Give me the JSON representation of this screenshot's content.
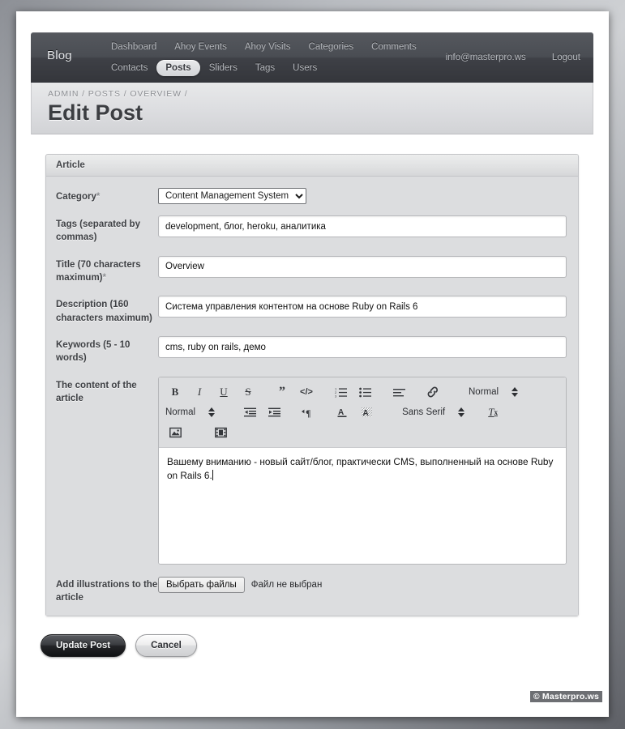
{
  "navbar": {
    "brand": "Blog",
    "row1": [
      {
        "label": "Dashboard",
        "active": false
      },
      {
        "label": "Ahoy Events",
        "active": false
      },
      {
        "label": "Ahoy Visits",
        "active": false
      },
      {
        "label": "Categories",
        "active": false
      },
      {
        "label": "Comments",
        "active": false
      }
    ],
    "row2": [
      {
        "label": "Contacts",
        "active": false
      },
      {
        "label": "Posts",
        "active": true
      },
      {
        "label": "Sliders",
        "active": false
      },
      {
        "label": "Tags",
        "active": false
      },
      {
        "label": "Users",
        "active": false
      }
    ],
    "account": "info@masterpro.ws",
    "logout": "Logout"
  },
  "header": {
    "breadcrumb": "ADMIN / POSTS / OVERVIEW /",
    "title": "Edit Post"
  },
  "panel": {
    "title": "Article"
  },
  "form": {
    "category": {
      "label": "Category",
      "required_mark": "*",
      "value": "Content Management System",
      "options": [
        "Content Management System"
      ]
    },
    "tags": {
      "label": "Tags (separated by commas)",
      "value": "development, блог, heroku, аналитика",
      "placeholder": ""
    },
    "title_field": {
      "label": "Title (70 characters maximum)",
      "required_mark": "*",
      "value": "Overview",
      "placeholder": ""
    },
    "description": {
      "label": "Description (160 characters maximum)",
      "value": "Система управления контентом на основе Ruby on Rails 6",
      "placeholder": ""
    },
    "keywords": {
      "label": "Keywords (5 - 10 words)",
      "value": "cms, ruby on rails, демо",
      "placeholder": ""
    },
    "content": {
      "label": "The content of the article",
      "body": "Вашему вниманию - новый сайт/блог, практически CMS, выполненный на основе Ruby on Rails 6."
    },
    "illustrations": {
      "label": "Add illustrations to the article",
      "button": "Выбрать файлы",
      "status": "Файл не выбран"
    }
  },
  "editor_toolbar": {
    "row1": [
      {
        "name": "bold",
        "glyph": "B"
      },
      {
        "name": "italic",
        "glyph": "I"
      },
      {
        "name": "underline",
        "glyph": "U"
      },
      {
        "name": "strike",
        "glyph": "S"
      },
      {
        "name": "blockquote",
        "glyph": "”"
      },
      {
        "name": "code-block",
        "glyph": "</>"
      },
      {
        "name": "ordered-list",
        "glyph": ""
      },
      {
        "name": "bullet-list",
        "glyph": ""
      },
      {
        "name": "align",
        "glyph": ""
      },
      {
        "name": "link",
        "glyph": ""
      }
    ],
    "header_picker": "Normal",
    "size_picker": "Normal",
    "font_picker": "Sans Serif",
    "row2": [
      {
        "name": "outdent",
        "glyph": ""
      },
      {
        "name": "indent",
        "glyph": ""
      },
      {
        "name": "text-direction",
        "glyph": ""
      },
      {
        "name": "text-color",
        "glyph": "A"
      },
      {
        "name": "background-color",
        "glyph": "A"
      },
      {
        "name": "clear-formatting",
        "glyph": "Tx"
      }
    ],
    "row3": [
      {
        "name": "insert-image",
        "glyph": ""
      },
      {
        "name": "insert-video",
        "glyph": ""
      }
    ]
  },
  "actions": {
    "submit": "Update Post",
    "cancel": "Cancel"
  },
  "footer": {
    "watermark": "© Masterpro.ws"
  },
  "colors": {
    "navbar_dark": "#3e4046",
    "panel_bg": "#dcdddf",
    "accent_dark": "#232427",
    "page_white": "#ffffff"
  }
}
